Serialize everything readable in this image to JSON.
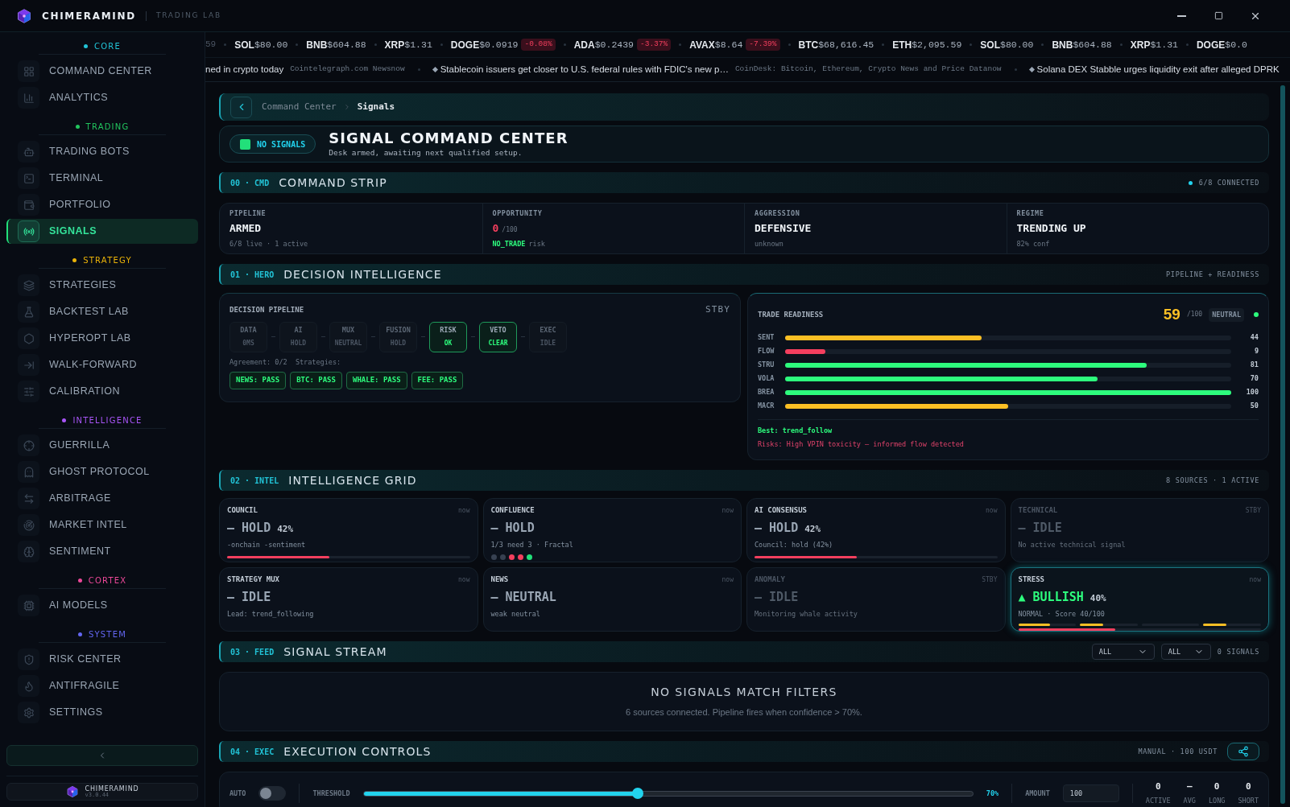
{
  "window": {
    "brand": "CHIMERAMIND",
    "subtitle": "TRADING LAB"
  },
  "ticker": {
    "leading_fragment": "59",
    "items": [
      {
        "symbol": "SOL",
        "price": "$80.00"
      },
      {
        "symbol": "BNB",
        "price": "$604.88"
      },
      {
        "symbol": "XRP",
        "price": "$1.31"
      },
      {
        "symbol": "DOGE",
        "price": "$0.0919",
        "change": "-0.08%"
      },
      {
        "symbol": "ADA",
        "price": "$0.2439",
        "change": "-3.37%"
      },
      {
        "symbol": "AVAX",
        "price": "$8.64",
        "change": "-7.39%"
      },
      {
        "symbol": "BTC",
        "price": "$68,616.45"
      },
      {
        "symbol": "ETH",
        "price": "$2,095.59"
      },
      {
        "symbol": "SOL",
        "price": "$80.00"
      },
      {
        "symbol": "BNB",
        "price": "$604.88"
      },
      {
        "symbol": "XRP",
        "price": "$1.31"
      },
      {
        "symbol": "DOGE",
        "price": "$0.0"
      }
    ]
  },
  "news": [
    {
      "headline": "ned in crypto today",
      "source": "Cointelegraph.com Newsnow",
      "marker": false
    },
    {
      "headline": "Stablecoin issuers get closer to U.S. federal rules with FDIC's new p…",
      "source": "CoinDesk: Bitcoin, Ethereum, Crypto News and Price Datanow",
      "marker": true
    },
    {
      "headline": "Solana DEX Stabble urges liquidity exit after alleged DPRK",
      "marker": true
    }
  ],
  "sidebar": {
    "sections": [
      {
        "title": "CORE",
        "color": "#22c3d6",
        "items": [
          {
            "label": "COMMAND CENTER",
            "selected": false
          },
          {
            "label": "ANALYTICS",
            "selected": false
          }
        ]
      },
      {
        "title": "TRADING",
        "color": "#22c55e",
        "items": [
          {
            "label": "TRADING BOTS",
            "selected": false
          },
          {
            "label": "TERMINAL",
            "selected": false
          },
          {
            "label": "PORTFOLIO",
            "selected": false
          },
          {
            "label": "SIGNALS",
            "selected": true
          }
        ]
      },
      {
        "title": "STRATEGY",
        "color": "#eab308",
        "items": [
          {
            "label": "STRATEGIES",
            "selected": false
          },
          {
            "label": "BACKTEST LAB",
            "selected": false
          },
          {
            "label": "HYPEROPT LAB",
            "selected": false
          },
          {
            "label": "WALK-FORWARD",
            "selected": false
          },
          {
            "label": "CALIBRATION",
            "selected": false
          }
        ]
      },
      {
        "title": "INTELLIGENCE",
        "color": "#a855f7",
        "items": [
          {
            "label": "GUERRILLA",
            "selected": false
          },
          {
            "label": "GHOST PROTOCOL",
            "selected": false
          },
          {
            "label": "ARBITRAGE",
            "selected": false
          },
          {
            "label": "MARKET INTEL",
            "selected": false
          },
          {
            "label": "SENTIMENT",
            "selected": false
          }
        ]
      },
      {
        "title": "CORTEX",
        "color": "#ec4899",
        "items": [
          {
            "label": "AI MODELS",
            "selected": false
          }
        ]
      },
      {
        "title": "SYSTEM",
        "color": "#6366f1",
        "items": [
          {
            "label": "RISK CENTER",
            "selected": false
          },
          {
            "label": "ANTIFRAGILE",
            "selected": false
          },
          {
            "label": "SETTINGS",
            "selected": false
          }
        ]
      }
    ],
    "footer": {
      "name": "CHIMERAMIND",
      "version": "v3.0.44"
    }
  },
  "breadcrumb": [
    "Command Center",
    "Signals"
  ],
  "header": {
    "badge": "NO SIGNALS",
    "title": "SIGNAL COMMAND CENTER",
    "subtitle": "Desk armed, awaiting next qualified setup."
  },
  "command_strip": {
    "code": "00 · CMD",
    "title": "COMMAND STRIP",
    "status": "6/8 CONNECTED",
    "cells": [
      {
        "label": "PIPELINE",
        "value": "ARMED",
        "alert": false,
        "note": "6/8 live · 1 active"
      },
      {
        "label": "OPPORTUNITY",
        "value": "0",
        "alert": true,
        "unit": "/100",
        "flag": "NO_TRADE",
        "note": "risk"
      },
      {
        "label": "AGGRESSION",
        "value": "DEFENSIVE",
        "alert": false,
        "note": "unknown"
      },
      {
        "label": "REGIME",
        "value": "TRENDING UP",
        "alert": false,
        "note": "82% conf"
      }
    ]
  },
  "hero": {
    "code": "01 · HERO",
    "title": "DECISION INTELLIGENCE",
    "status": "PIPELINE + READINESS",
    "pipeline": {
      "title": "DECISION PIPELINE",
      "status": "STBY",
      "stages": [
        {
          "name": "DATA",
          "value": "0MS",
          "active": false
        },
        {
          "name": "AI",
          "value": "HOLD",
          "active": false
        },
        {
          "name": "MUX",
          "value": "NEUTRAL",
          "active": false
        },
        {
          "name": "FUSION",
          "value": "HOLD",
          "active": false
        },
        {
          "name": "RISK",
          "value": "OK",
          "active": true
        },
        {
          "name": "VETO",
          "value": "CLEAR",
          "active": true
        },
        {
          "name": "EXEC",
          "value": "IDLE",
          "active": false
        }
      ],
      "agreement": "Agreement: 0/2  Strategies:",
      "chips": [
        "NEWS: PASS",
        "BTC: PASS",
        "WHALE: PASS",
        "FEE: PASS"
      ]
    },
    "readiness": {
      "title": "TRADE READINESS",
      "score": "59",
      "unit": "/100",
      "badge": "NEUTRAL",
      "live": true,
      "bars": [
        {
          "label": "SENT",
          "level": 0.44,
          "value": "44",
          "color": "#fbbf24"
        },
        {
          "label": "FLOW",
          "level": 0.09,
          "value": "9",
          "color": "#f43f5e"
        },
        {
          "label": "STRU",
          "level": 0.81,
          "value": "81",
          "color": "#2dfc7d"
        },
        {
          "label": "VOLA",
          "level": 0.7,
          "value": "70",
          "color": "#2dfc7d"
        },
        {
          "label": "BREA",
          "level": 1,
          "value": "100",
          "color": "#2dfc7d"
        },
        {
          "label": "MACR",
          "level": 0.5,
          "value": "50",
          "color": "#fbbf24"
        }
      ],
      "best": "Best: trend_follow",
      "risks": "Risks: High VPIN toxicity — informed flow detected"
    }
  },
  "intel": {
    "code": "02 · INTEL",
    "title": "INTELLIGENCE GRID",
    "status": "8 SOURCES · 1 ACTIVE",
    "cards": [
      {
        "kind": "bar",
        "title": "COUNCIL",
        "time": "now",
        "signal": "— HOLD",
        "bullish": false,
        "pct": "42%",
        "note": "-onchain -sentiment",
        "level": 0.42,
        "dimmed": false,
        "highlighted": false
      },
      {
        "kind": "dots",
        "title": "CONFLUENCE",
        "time": "now",
        "signal": "— HOLD",
        "bullish": false,
        "note": "1/3 need 3 · Fractal",
        "dots": [
          {
            "color": "#374151"
          },
          {
            "color": "#374151"
          },
          {
            "color": "#f43f5e"
          },
          {
            "color": "#f43f5e"
          },
          {
            "color": "#22e07a"
          }
        ],
        "dimmed": false,
        "highlighted": false
      },
      {
        "kind": "bar",
        "title": "AI CONSENSUS",
        "time": "now",
        "signal": "— HOLD",
        "bullish": false,
        "pct": "42%",
        "note": "Council: hold (42%)",
        "level": 0.42,
        "dimmed": false,
        "highlighted": false
      },
      {
        "kind": "plain",
        "title": "TECHNICAL",
        "time": "STBY",
        "signal": "— IDLE",
        "bullish": false,
        "note": "No active technical signal",
        "dimmed": true,
        "highlighted": false
      },
      {
        "kind": "plain",
        "title": "STRATEGY MUX",
        "time": "now",
        "signal": "— IDLE",
        "bullish": false,
        "note": "Lead: trend_following",
        "dimmed": false,
        "highlighted": false
      },
      {
        "kind": "plain",
        "title": "NEWS",
        "time": "now",
        "signal": "— NEUTRAL",
        "bullish": false,
        "note": "weak neutral",
        "dimmed": false,
        "highlighted": false
      },
      {
        "kind": "plain",
        "title": "ANOMALY",
        "time": "STBY",
        "signal": "— IDLE",
        "bullish": false,
        "note": "Monitoring whale activity",
        "dimmed": true,
        "highlighted": false
      },
      {
        "kind": "stress",
        "title": "STRESS",
        "time": "now",
        "signal": "▲ BULLISH",
        "bullish": true,
        "pct": "40%",
        "note": "NORMAL · Score 40/100",
        "segments": [
          {
            "level": 0.55
          },
          {
            "level": 0.4
          },
          {
            "level": 0
          },
          {
            "level": 0.4
          }
        ],
        "level": 0.4,
        "dimmed": false,
        "highlighted": true
      }
    ]
  },
  "feed": {
    "code": "03 · FEED",
    "title": "SIGNAL STREAM",
    "filters": [
      "ALL",
      "ALL"
    ],
    "count": "0 SIGNALS",
    "empty_title": "NO SIGNALS MATCH FILTERS",
    "empty_text": "6 sources connected. Pipeline fires when confidence > 70%."
  },
  "execution": {
    "code": "04 · EXEC",
    "title": "EXECUTION CONTROLS",
    "status": "MANUAL · 100 USDT",
    "auto": {
      "label": "AUTO",
      "on": false
    },
    "threshold": {
      "label": "THRESHOLD",
      "level": 0.45,
      "reading": "70%"
    },
    "amount": {
      "label": "AMOUNT",
      "value": "100"
    },
    "stats": [
      {
        "value": "0",
        "label": "ACTIVE"
      },
      {
        "value": "—",
        "label": "AVG"
      },
      {
        "value": "0",
        "label": "LONG"
      },
      {
        "value": "0",
        "label": "SHORT"
      }
    ]
  }
}
